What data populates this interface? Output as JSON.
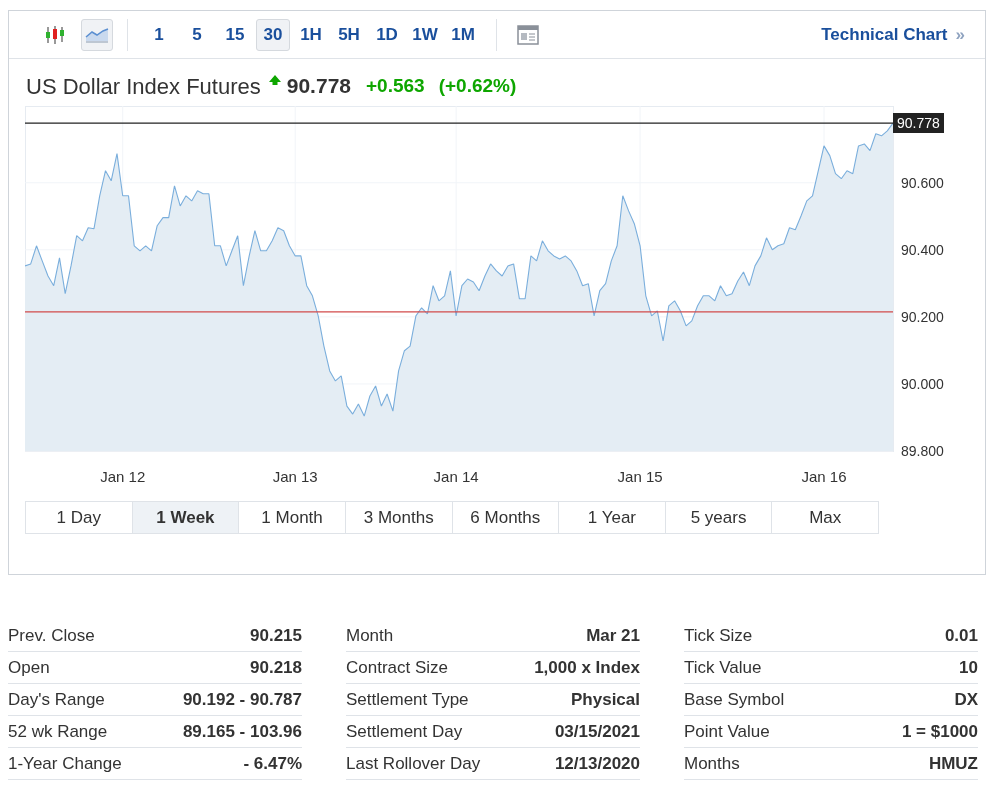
{
  "toolbar": {
    "chart_types": [
      {
        "kind": "candlestick",
        "selected": false
      },
      {
        "kind": "line",
        "selected": true
      }
    ],
    "intervals": [
      {
        "label": "1",
        "selected": false
      },
      {
        "label": "5",
        "selected": false
      },
      {
        "label": "15",
        "selected": false
      },
      {
        "label": "30",
        "selected": true
      },
      {
        "label": "1H",
        "selected": false
      },
      {
        "label": "5H",
        "selected": false
      },
      {
        "label": "1D",
        "selected": false
      },
      {
        "label": "1W",
        "selected": false
      },
      {
        "label": "1M",
        "selected": false
      }
    ],
    "link": {
      "label": "Technical Chart",
      "arrow": "»"
    }
  },
  "quote": {
    "name": "US Dollar Index Futures",
    "price": "90.778",
    "change": "+0.563",
    "change_percent": "(+0.62%)"
  },
  "chart": {
    "chart_data": {
      "type": "area",
      "categories": [
        null,
        null,
        null,
        null,
        null,
        null,
        null,
        null,
        null,
        null,
        null,
        null,
        null,
        null,
        null,
        null,
        null,
        "Jan 12",
        null,
        null,
        null,
        null,
        null,
        null,
        null,
        null,
        null,
        null,
        null,
        null,
        null,
        null,
        null,
        null,
        null,
        null,
        null,
        null,
        null,
        null,
        null,
        null,
        null,
        null,
        null,
        null,
        null,
        "Jan 13",
        null,
        null,
        null,
        null,
        null,
        null,
        null,
        null,
        null,
        null,
        null,
        null,
        null,
        null,
        null,
        null,
        null,
        null,
        null,
        null,
        null,
        null,
        null,
        null,
        null,
        null,
        null,
        "Jan 14",
        null,
        null,
        null,
        null,
        null,
        null,
        null,
        null,
        null,
        null,
        null,
        null,
        null,
        null,
        null,
        null,
        null,
        null,
        null,
        null,
        null,
        null,
        null,
        null,
        null,
        null,
        null,
        null,
        null,
        null,
        null,
        "Jan 15",
        null,
        null,
        null,
        null,
        null,
        null,
        null,
        null,
        null,
        null,
        null,
        null,
        null,
        null,
        null,
        null,
        null,
        null,
        null,
        null,
        null,
        null,
        null,
        null,
        null,
        null,
        null,
        null,
        null,
        null,
        null,
        "Jan 16",
        null,
        null,
        null,
        null,
        null,
        null,
        null,
        null,
        null,
        null,
        null,
        null
      ],
      "series": [
        {
          "color": "#7aaedc",
          "values": [
            90.352,
            90.358,
            90.412,
            90.367,
            90.322,
            90.293,
            90.376,
            90.269,
            90.352,
            90.442,
            90.427,
            90.466,
            90.463,
            90.561,
            90.636,
            90.606,
            90.687,
            90.561,
            90.561,
            90.412,
            90.397,
            90.412,
            90.397,
            90.472,
            90.496,
            90.496,
            90.591,
            90.531,
            90.561,
            90.546,
            90.576,
            90.567,
            90.567,
            90.412,
            90.412,
            90.352,
            90.397,
            90.442,
            90.293,
            90.382,
            90.457,
            90.397,
            90.397,
            90.427,
            90.466,
            90.457,
            90.412,
            90.382,
            90.382,
            90.293,
            90.263,
            90.203,
            90.113,
            90.039,
            90.009,
            90.024,
            89.934,
            89.91,
            89.94,
            89.904,
            89.964,
            89.994,
            89.934,
            89.97,
            89.919,
            90.039,
            90.099,
            90.113,
            90.203,
            90.227,
            90.209,
            90.293,
            90.248,
            90.263,
            90.337,
            90.203,
            90.293,
            90.313,
            90.304,
            90.278,
            90.322,
            90.358,
            90.337,
            90.322,
            90.352,
            90.358,
            90.254,
            90.254,
            90.382,
            90.367,
            90.427,
            90.397,
            90.382,
            90.373,
            90.382,
            90.367,
            90.337,
            90.293,
            90.299,
            90.203,
            90.278,
            90.299,
            90.367,
            90.412,
            90.561,
            90.516,
            90.478,
            90.412,
            90.263,
            90.203,
            90.218,
            90.128,
            90.233,
            90.248,
            90.218,
            90.173,
            90.188,
            90.233,
            90.263,
            90.263,
            90.248,
            90.293,
            90.263,
            90.269,
            90.307,
            90.334,
            90.293,
            90.352,
            90.382,
            90.436,
            90.4,
            90.412,
            90.418,
            90.466,
            90.46,
            90.501,
            90.546,
            90.561,
            90.636,
            90.71,
            90.681,
            90.627,
            90.612,
            90.636,
            90.627,
            90.71,
            90.716,
            90.696,
            90.746,
            90.74,
            90.755,
            90.778
          ]
        }
      ],
      "ylim": [
        89.8,
        90.82
      ],
      "yticks": [
        {
          "value": 89.8,
          "label": "89.800"
        },
        {
          "value": 90.0,
          "label": "90.000"
        },
        {
          "value": 90.2,
          "label": "90.200"
        },
        {
          "value": 90.4,
          "label": "90.400"
        },
        {
          "value": 90.6,
          "label": "90.600"
        }
      ],
      "grid": true,
      "ref_lines": [
        {
          "axis": "y",
          "value": 90.778,
          "label": "90.778",
          "color": "#222222"
        },
        {
          "axis": "y",
          "value": 90.215,
          "color": "#d24b4b"
        }
      ]
    }
  },
  "ranges": [
    {
      "label": "1 Day",
      "selected": false
    },
    {
      "label": "1 Week",
      "selected": true
    },
    {
      "label": "1 Month",
      "selected": false
    },
    {
      "label": "3 Months",
      "selected": false
    },
    {
      "label": "6 Months",
      "selected": false
    },
    {
      "label": "1 Year",
      "selected": false
    },
    {
      "label": "5 years",
      "selected": false
    },
    {
      "label": "Max",
      "selected": false
    }
  ],
  "details": [
    [
      {
        "label": "Prev. Close",
        "value": "90.215"
      },
      {
        "label": "Open",
        "value": "90.218"
      },
      {
        "label": "Day's Range",
        "value": "90.192 - 90.787"
      },
      {
        "label": "52 wk Range",
        "value": "89.165 - 103.96"
      },
      {
        "label": "1-Year Change",
        "value": "- 6.47%"
      }
    ],
    [
      {
        "label": "Month",
        "value": "Mar 21"
      },
      {
        "label": "Contract Size",
        "value": "1,000 x Index"
      },
      {
        "label": "Settlement Type",
        "value": "Physical"
      },
      {
        "label": "Settlement Day",
        "value": "03/15/2021"
      },
      {
        "label": "Last Rollover Day",
        "value": "12/13/2020"
      }
    ],
    [
      {
        "label": "Tick Size",
        "value": "0.01"
      },
      {
        "label": "Tick Value",
        "value": "10"
      },
      {
        "label": "Base Symbol",
        "value": "DX"
      },
      {
        "label": "Point Value",
        "value": "1 = $1000"
      },
      {
        "label": "Months",
        "value": "HMUZ"
      }
    ]
  ]
}
